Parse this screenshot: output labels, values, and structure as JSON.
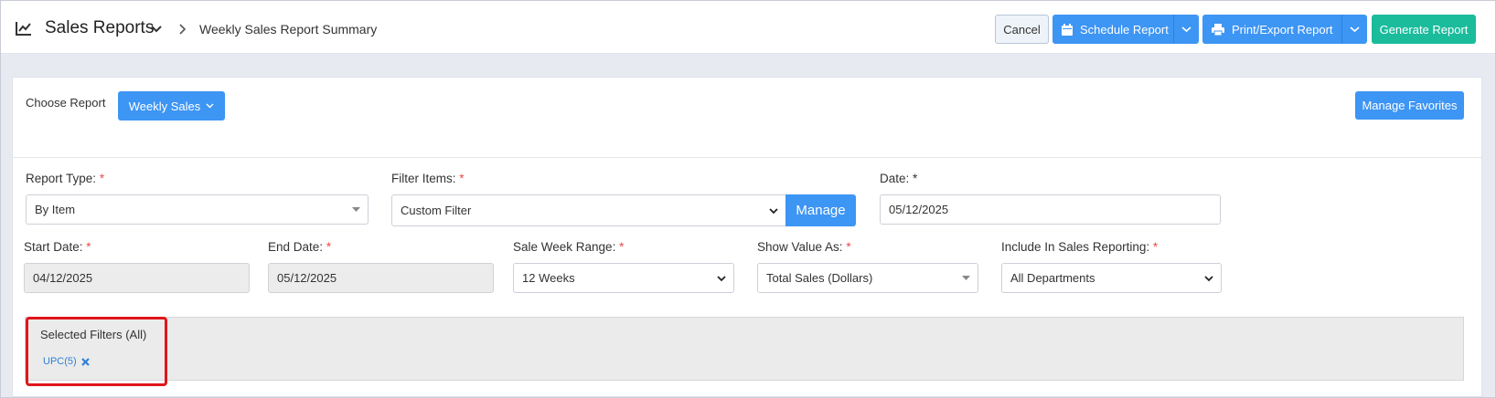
{
  "header": {
    "icon": "chart-line-icon",
    "title": "Sales Reports",
    "breadcrumb": "Weekly Sales Report Summary",
    "cancel_label": "Cancel",
    "schedule_label": "Schedule Report",
    "print_label": "Print/Export Report",
    "generate_label": "Generate Report"
  },
  "choose": {
    "label": "Choose Report",
    "selected": "Weekly Sales",
    "favorites_label": "Manage Favorites"
  },
  "form": {
    "report_type": {
      "label": "Report Type:",
      "value": "By Item"
    },
    "filter_items": {
      "label": "Filter Items:",
      "value": "Custom Filter",
      "manage_label": "Manage"
    },
    "date": {
      "label": "Date:",
      "value": "05/12/2025"
    },
    "start_date": {
      "label": "Start Date:",
      "value": "04/12/2025"
    },
    "end_date": {
      "label": "End Date:",
      "value": "05/12/2025"
    },
    "week_range": {
      "label": "Sale Week Range:",
      "value": "12 Weeks"
    },
    "show_value": {
      "label": "Show Value As:",
      "value": "Total Sales (Dollars)"
    },
    "include": {
      "label": "Include In Sales Reporting:",
      "value": "All Departments"
    }
  },
  "filters": {
    "title": "Selected Filters (All)",
    "tags": [
      {
        "label": "UPC(5)"
      }
    ]
  },
  "colors": {
    "primary": "#3d95f4",
    "teal": "#1abc9c",
    "required": "#e84c4c",
    "highlight": "#e0161a"
  }
}
